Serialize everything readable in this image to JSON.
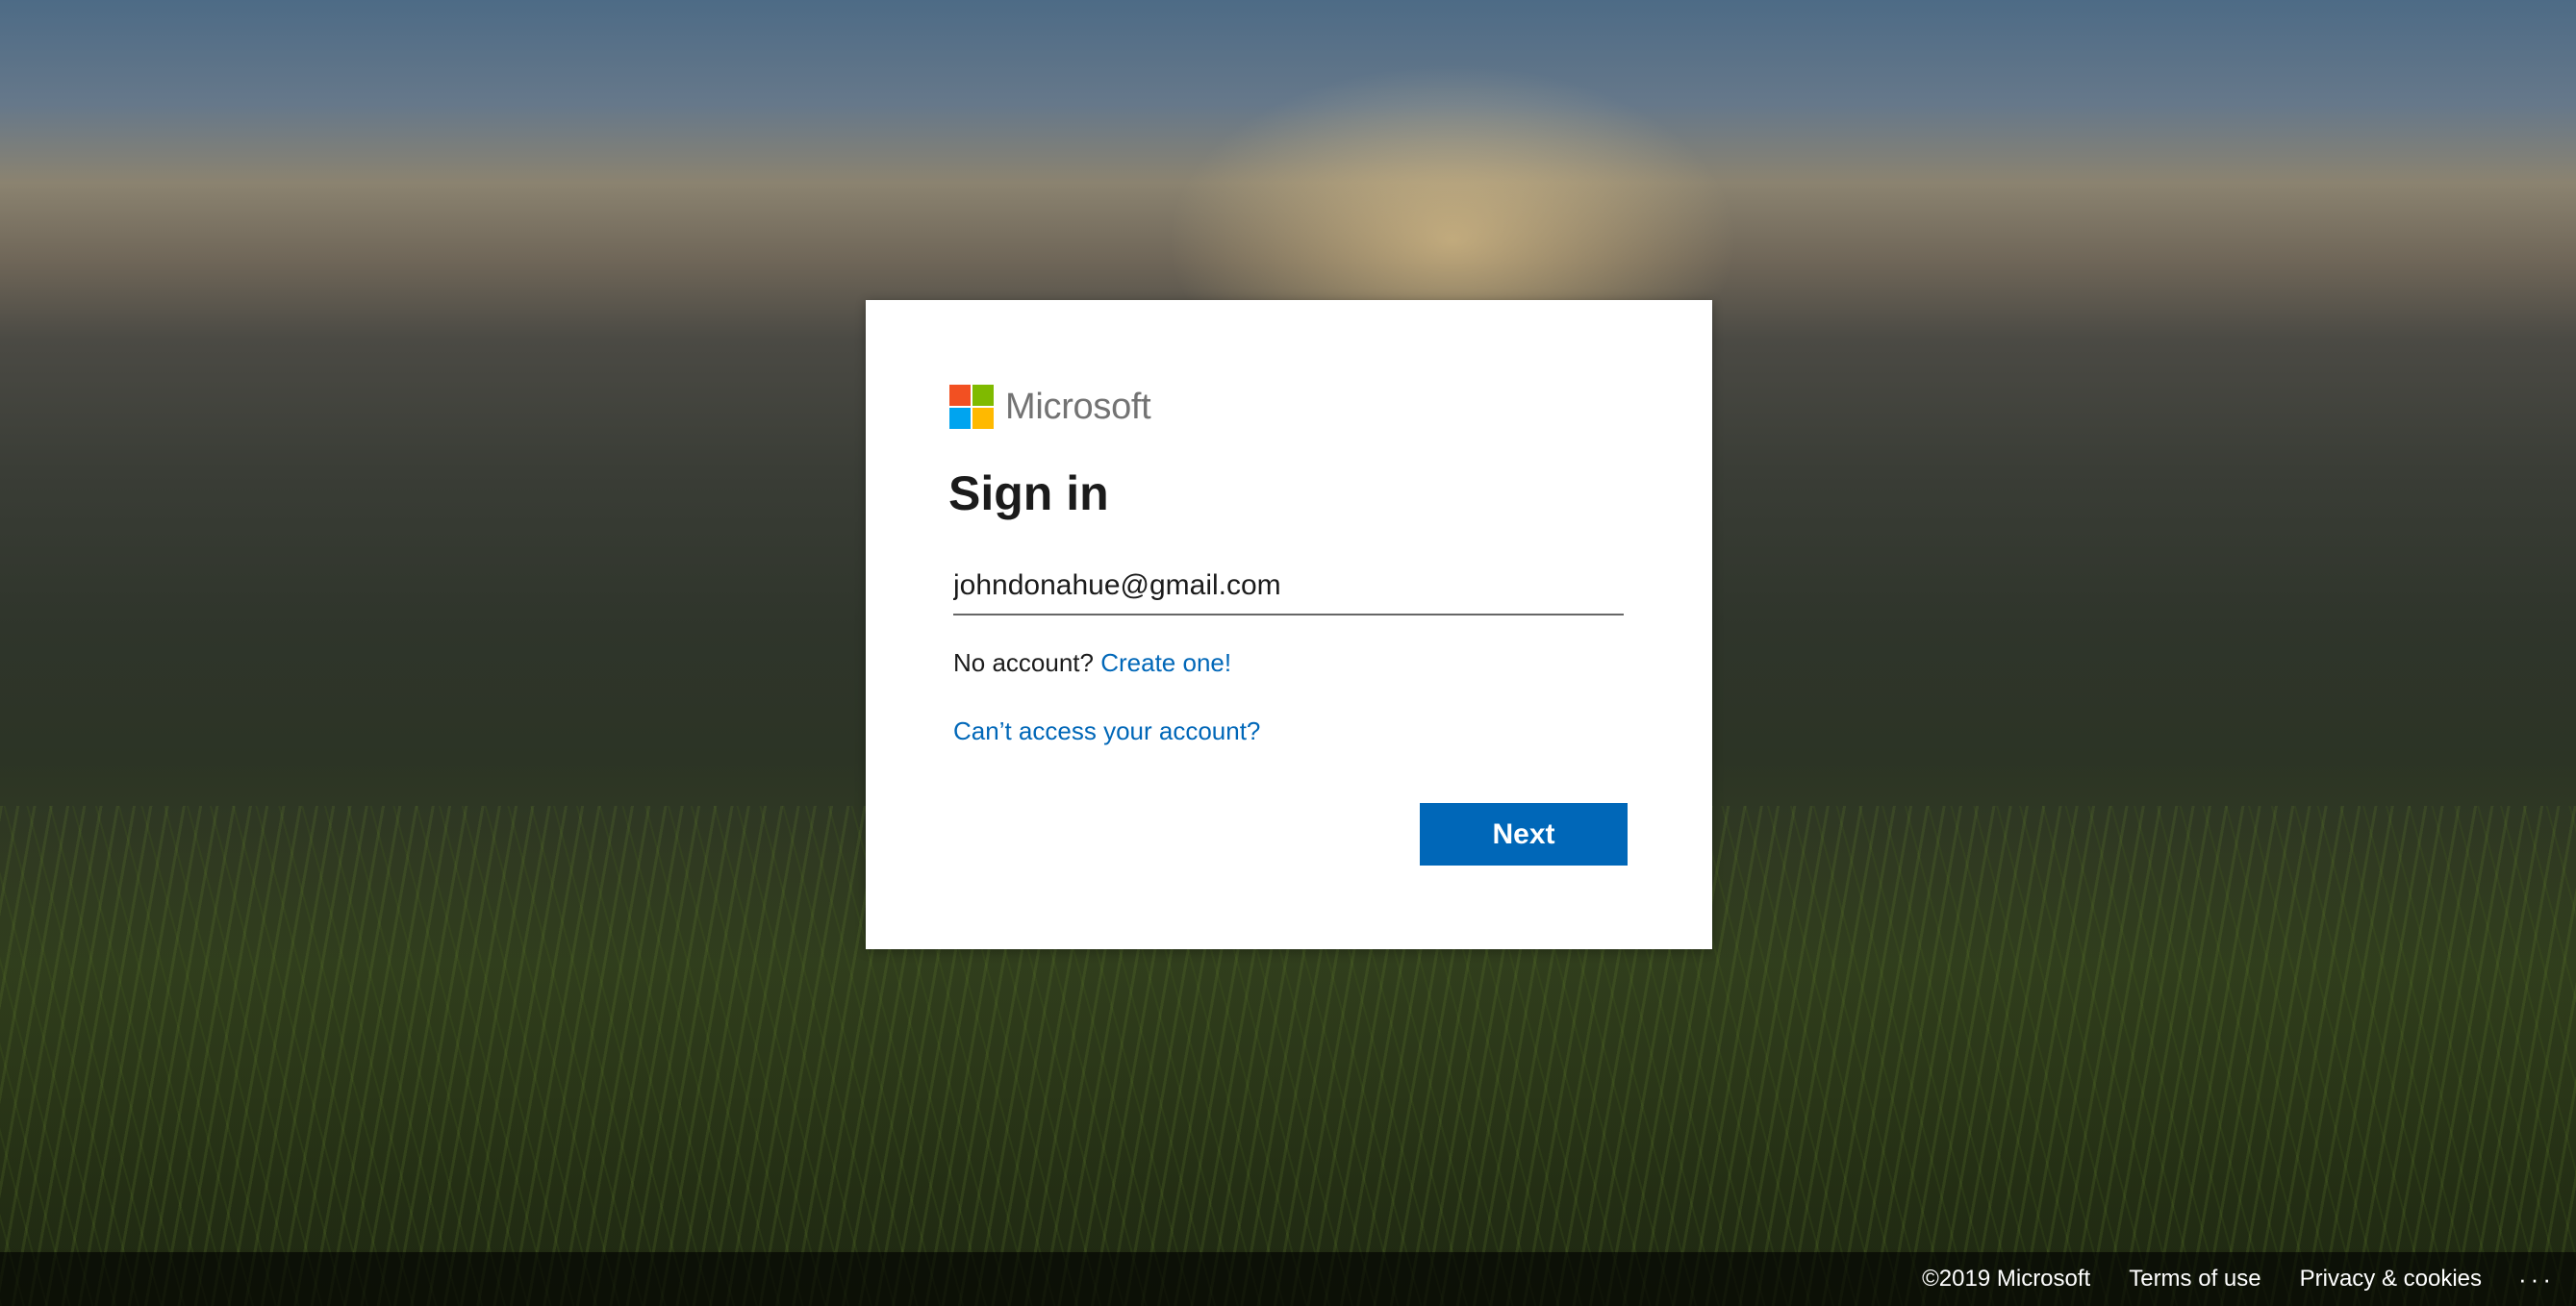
{
  "brand": {
    "name": "Microsoft",
    "logo_colors": [
      "#f25022",
      "#7fba00",
      "#00a4ef",
      "#ffb900"
    ],
    "accent": "#0067b8"
  },
  "signin": {
    "title": "Sign in",
    "email_value": "johndonahue@gmail.com",
    "no_account_text": "No account?",
    "create_link": "Create one!",
    "cant_access_link": "Can’t access your account?",
    "next_label": "Next"
  },
  "footer": {
    "copyright": "©2019 Microsoft",
    "terms": "Terms of use",
    "privacy": "Privacy & cookies",
    "more": "···"
  }
}
